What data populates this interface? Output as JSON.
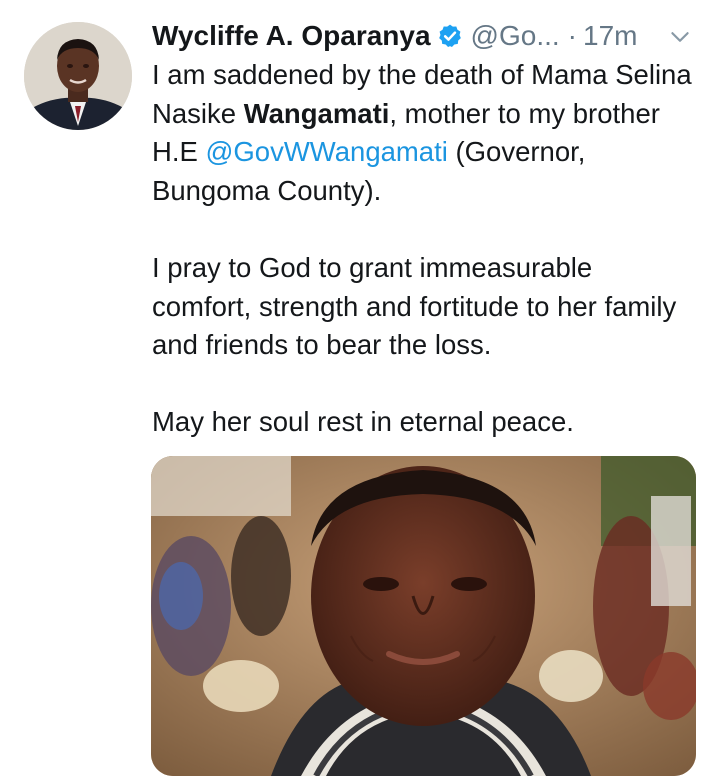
{
  "tweet": {
    "author_name": "Wycliffe A. Oparanya",
    "author_handle": "@Go...",
    "separator": "·",
    "time": "17m",
    "verified": true,
    "text": {
      "line1_a": "I am saddened by the death of Mama Selina Nasike ",
      "line1_bold": "Wangamati",
      "line1_b": ", mother to my brother H.E ",
      "mention": "@GovWWangamati",
      "line1_c": " (Governor, Bungoma County).",
      "para2": "I pray to God to grant immeasurable comfort, strength and fortitude to her family and friends to bear the loss.",
      "para3": "May her soul rest in eternal peace."
    },
    "icons": {
      "avatar": "avatar-photo",
      "verified": "verified-badge-icon",
      "menu": "chevron-down-icon"
    },
    "colors": {
      "text": "#14171a",
      "secondary": "#657786",
      "link": "#1b95e0",
      "verified": "#1da1f2"
    }
  }
}
